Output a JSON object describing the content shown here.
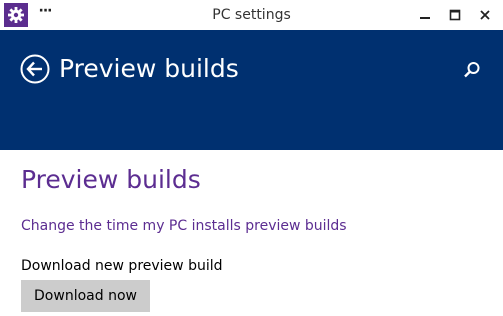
{
  "window": {
    "title": "PC settings",
    "more_label": "···"
  },
  "header": {
    "title": "Preview builds",
    "back_icon": "back-arrow-circle-icon",
    "search_icon": "search-icon"
  },
  "main": {
    "page_title": "Preview builds",
    "change_time_link": "Change the time my PC installs preview builds",
    "download_label": "Download new preview build",
    "download_button": "Download now"
  },
  "colors": {
    "header_bg": "#003070",
    "accent": "#5c2d91",
    "button_bg": "#cccccc"
  }
}
